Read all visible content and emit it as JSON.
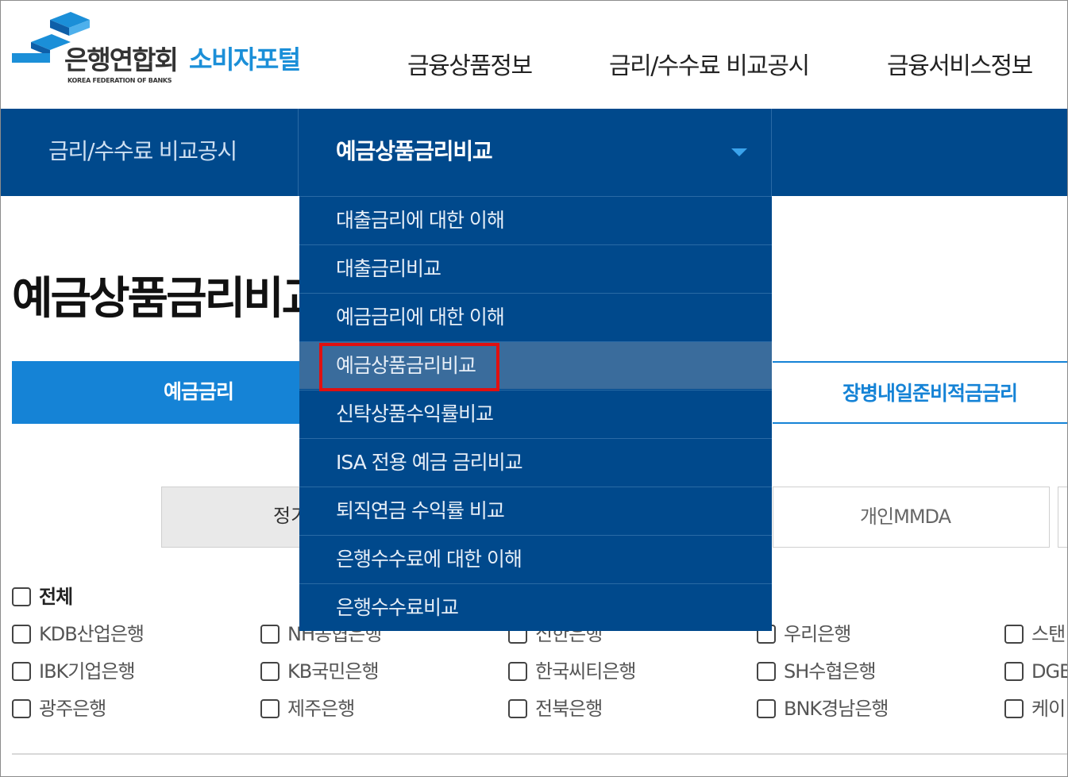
{
  "header": {
    "logo_ko": "은행연합회",
    "logo_en": "KOREA FEDERATION OF BANKS",
    "portal_label": "소비자포털",
    "nav": [
      "금융상품정보",
      "금리/수수료 비교공시",
      "금융서비스정보"
    ]
  },
  "bar": {
    "section": "금리/수수료 비교공시",
    "current": "예금상품금리비교",
    "caret_icon": "caret-down-icon"
  },
  "page": {
    "title": "예금상품금리비교"
  },
  "tabs": {
    "active": "예금금리",
    "right": "장병내일준비적금금리"
  },
  "subtabs": {
    "left": "정기",
    "right": "개인MMDA"
  },
  "checkboxes": {
    "all": "전체",
    "rows": [
      [
        "KDB산업은행",
        "NH농협은행",
        "신한은행",
        "우리은행",
        "스탠"
      ],
      [
        "IBK기업은행",
        "KB국민은행",
        "한국씨티은행",
        "SH수협은행",
        "DGB"
      ],
      [
        "광주은행",
        "제주은행",
        "전북은행",
        "BNK경남은행",
        "케이"
      ]
    ]
  },
  "dropdown": {
    "items": [
      "대출금리에 대한 이해",
      "대출금리비교",
      "예금금리에 대한 이해",
      "예금상품금리비교",
      "신탁상품수익률비교",
      "ISA 전용 예금 금리비교",
      "퇴직연금 수익률 비교",
      "은행수수료에 대한 이해",
      "은행수수료비교"
    ],
    "selected_index": 3
  },
  "colors": {
    "navy": "#00498c",
    "accent_blue": "#1583d6",
    "highlight_red": "#e01010"
  }
}
